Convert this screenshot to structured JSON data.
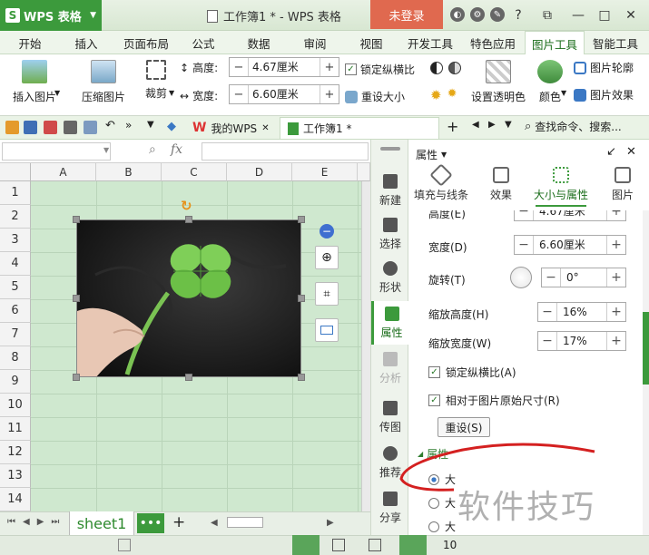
{
  "app": {
    "name": "WPS 表格",
    "doc_title": "工作簿1 * - WPS 表格",
    "login": "未登录"
  },
  "menu": [
    "开始",
    "插入",
    "页面布局",
    "公式",
    "数据",
    "审阅",
    "视图",
    "开发工具",
    "特色应用",
    "图片工具",
    "智能工具"
  ],
  "ribbon": {
    "insert_picture": "插入图片",
    "compress_picture": "压缩图片",
    "crop": "裁剪",
    "height_label": "高度:",
    "height_value": "4.67厘米",
    "width_label": "宽度:",
    "width_value": "6.60厘米",
    "lock_ratio": "锁定纵横比",
    "reset_size": "重设大小",
    "set_transparent": "设置透明色",
    "color": "颜色",
    "picture_outline": "图片轮廓",
    "picture_effect": "图片效果"
  },
  "quickbar": {
    "tab_mywps": "我的WPS",
    "tab_workbook": "工作簿1 *",
    "search": "查找命令、搜索..."
  },
  "formula": {
    "fx": "fx"
  },
  "grid": {
    "columns": [
      "A",
      "B",
      "C",
      "D",
      "E"
    ],
    "rows": [
      "1",
      "2",
      "3",
      "4",
      "5",
      "6",
      "7",
      "8",
      "9",
      "10",
      "11",
      "12",
      "13",
      "14"
    ]
  },
  "sheet": {
    "name": "sheet1"
  },
  "side": [
    "新建",
    "选择",
    "形状",
    "属性",
    "分析",
    "传图",
    "推荐",
    "分享"
  ],
  "props": {
    "title": "属性",
    "tabs": [
      "填充与线条",
      "效果",
      "大小与属性",
      "图片"
    ],
    "height_label": "高度(E)",
    "height_value": "4.67厘米",
    "width_label": "宽度(D)",
    "width_value": "6.60厘米",
    "rotate_label": "旋转(T)",
    "rotate_value": "0°",
    "scale_h_label": "缩放高度(H)",
    "scale_h_value": "16%",
    "scale_w_label": "缩放宽度(W)",
    "scale_w_value": "17%",
    "lock_ratio": "锁定纵横比(A)",
    "relative": "相对于图片原始尺寸(R)",
    "reset": "重设(S)",
    "section": "属性",
    "radio1": "大",
    "radio2": "大",
    "radio3": "大"
  },
  "status": {
    "zoom": "10"
  },
  "watermark": "软件技巧"
}
